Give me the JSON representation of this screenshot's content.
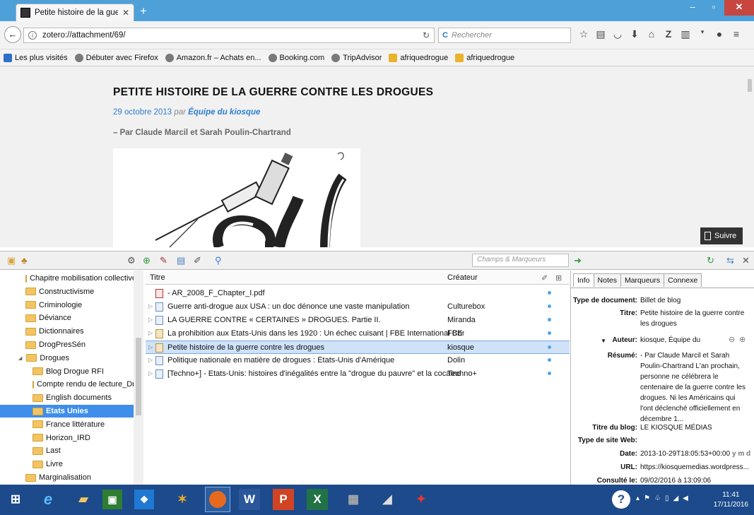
{
  "browser": {
    "tab_title": "Petite histoire de la guerre...",
    "tab_close": "✕",
    "new_tab": "+",
    "url": "zotero://attachment/69/",
    "search_placeholder": "Rechercher",
    "search_engine_icon": "C",
    "bookmarks": [
      "Les plus visités",
      "Débuter avec Firefox",
      "Amazon.fr – Achats en...",
      "Booking.com",
      "TripAdvisor",
      "afriquedrogue",
      "afriquedrogue"
    ]
  },
  "article": {
    "title": "PETITE HISTOIRE DE LA GUERRE CONTRE LES DROGUES",
    "date": "29 octobre 2013",
    "par": "par",
    "author": "Équipe du kiosque",
    "byline": "– Par Claude Marcil et Sarah Poulin-Chartrand",
    "follow_label": "Suivre"
  },
  "zotero": {
    "search_placeholder": "Champs & Marqueurs",
    "collections": [
      {
        "label": "Chapitre mobilisation collectives",
        "indent": 0
      },
      {
        "label": "Constructivisme",
        "indent": 0
      },
      {
        "label": "Criminologie",
        "indent": 0
      },
      {
        "label": "Déviance",
        "indent": 0
      },
      {
        "label": "Dictionnaires",
        "indent": 0
      },
      {
        "label": "DrogPresSén",
        "indent": 0
      },
      {
        "label": "Drogues",
        "indent": 0,
        "open": true
      },
      {
        "label": "Blog Drogue RFI",
        "indent": 1
      },
      {
        "label": "Compte rendu de lecture_Dr...",
        "indent": 1
      },
      {
        "label": "English documents",
        "indent": 1
      },
      {
        "label": "Etats Unies",
        "indent": 1,
        "selected": true
      },
      {
        "label": "France littérature",
        "indent": 1
      },
      {
        "label": "Horizon_IRD",
        "indent": 1
      },
      {
        "label": "Last",
        "indent": 1
      },
      {
        "label": "Livre",
        "indent": 1
      },
      {
        "label": "Marginalisation",
        "indent": 0
      }
    ],
    "columns": {
      "title": "Titre",
      "creator": "Créateur"
    },
    "items": [
      {
        "title": "- AR_2008_F_Chapter_I.pdf",
        "creator": "",
        "type": "pdf",
        "twisty": false
      },
      {
        "title": "Guerre anti-drogue aux USA : un doc dénonce une vaste manipulation",
        "creator": "Culturebox",
        "type": "doc",
        "twisty": true
      },
      {
        "title": "LA GUERRE CONTRE « CERTAINES » DROGUES. Partie II.",
        "creator": "Miranda",
        "type": "doc",
        "twisty": true
      },
      {
        "title": "La prohibition aux Etats-Unis dans les 1920 : Un échec cuisant | FBE International Consultants",
        "creator": "FBE",
        "type": "img",
        "twisty": true
      },
      {
        "title": "Petite histoire de la guerre contre les drogues",
        "creator": "kiosque",
        "type": "img",
        "twisty": true,
        "selected": true
      },
      {
        "title": "Politique nationale en matière de drogues : États-Unis d'Amérique",
        "creator": "Dolin",
        "type": "doc",
        "twisty": true
      },
      {
        "title": "[Techno+] - Etats-Unis: histoires d'inégalités entre la \"drogue du pauvre\" et la cocaïne",
        "creator": "Techno+",
        "type": "doc",
        "twisty": true
      }
    ],
    "info_tabs": [
      "Info",
      "Notes",
      "Marqueurs",
      "Connexe"
    ],
    "info": {
      "type_label": "Type de document:",
      "type_value": "Billet de blog",
      "title_label": "Titre:",
      "title_value": "Petite histoire de la guerre contre les drogues",
      "author_label": "Auteur:",
      "author_value": "kiosque, Équipe du",
      "abstract_label": "Résumé:",
      "abstract_value": "- Par Claude Marcil et Sarah Poulin-Chartrand  L'an prochain, personne ne célébrera le centenaire de la guerre contre les drogues. Ni les Américains qui l'ont déclenché officiellement en décembre 1...",
      "blog_label": "Titre du blog:",
      "blog_value": "LE KIOSQUE MÉDIAS",
      "site_label": "Type de site Web:",
      "site_value": "",
      "date_label": "Date:",
      "date_value": "2013-10-29T18:05:53+00:00",
      "date_ymd": "y m d",
      "url_label": "URL:",
      "url_value": "https://kiosquemedias.wordpress...",
      "accessed_label": "Consulté le:",
      "accessed_value": "09/02/2016 à 13:09:06"
    }
  },
  "taskbar": {
    "time": "11:41",
    "date": "17/11/2016",
    "word_label": "W",
    "ppt_label": "P",
    "excel_label": "X"
  },
  "colors": {
    "accent": "#3e8eea",
    "titlebar": "#4ea0d9",
    "taskbar": "#1c4a8a"
  }
}
